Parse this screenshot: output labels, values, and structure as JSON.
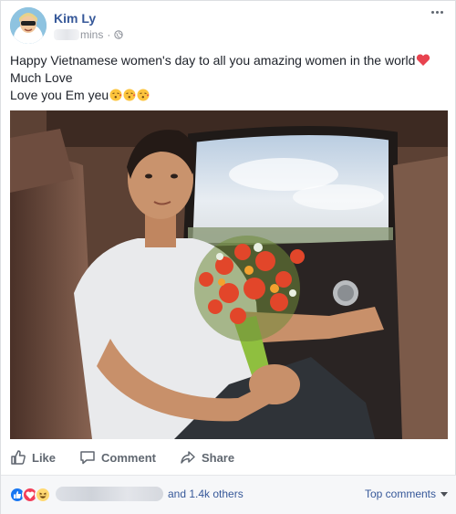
{
  "author": {
    "name": "Kim Ly",
    "time": "mins"
  },
  "post": {
    "line1": "Happy Vietnamese women's day to all you amazing women in the world",
    "line2": "Much Love",
    "line3": "Love you Em yeu"
  },
  "actions": {
    "like": "Like",
    "comment": "Comment",
    "share": "Share"
  },
  "reactions": {
    "others": "and 1.4k others",
    "sort": "Top comments"
  },
  "colors": {
    "link": "#365899",
    "muted": "#90949c",
    "like_blue": "#1877f2",
    "love_red": "#f33e58",
    "haha_yellow": "#ffd972"
  }
}
